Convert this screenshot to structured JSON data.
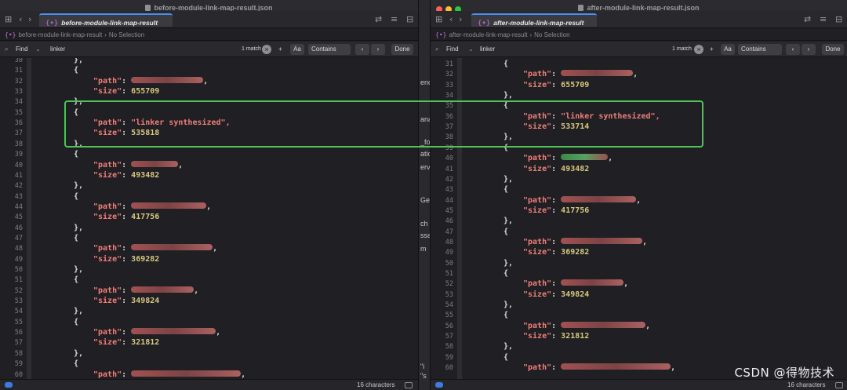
{
  "left": {
    "title": "before-module-link-map-result.json",
    "tab_label": "before-module-link-map-result",
    "jump_file": "before-module-link-map-result",
    "jump_selection": "No Selection",
    "find_mode": "Find",
    "find_query": "linker",
    "match_count": "1 match",
    "match_case": "Aa",
    "contains": "Contains",
    "done": "Done",
    "status_count": "16 characters",
    "lines": [
      {
        "n": "30",
        "t": "punc",
        "v": "},"
      },
      {
        "n": "31",
        "t": "punc",
        "v": "{"
      },
      {
        "n": "32",
        "t": "kv",
        "k": "\"path\"",
        "v": "",
        "redacted": true
      },
      {
        "n": "33",
        "t": "kvnum",
        "k": "\"size\"",
        "v": "655709"
      },
      {
        "n": "34",
        "t": "punc",
        "v": "},"
      },
      {
        "n": "35",
        "t": "punc",
        "v": "{"
      },
      {
        "n": "36",
        "t": "kvstr",
        "k": "\"path\"",
        "v": "\"linker synthesized\","
      },
      {
        "n": "37",
        "t": "kvnum",
        "k": "\"size\"",
        "v": "535818"
      },
      {
        "n": "38",
        "t": "punc",
        "v": "},"
      },
      {
        "n": "39",
        "t": "punc",
        "v": "{"
      },
      {
        "n": "40",
        "t": "kv",
        "k": "\"path\"",
        "v": "",
        "redacted": true
      },
      {
        "n": "41",
        "t": "kvnum",
        "k": "\"size\"",
        "v": "493482"
      },
      {
        "n": "42",
        "t": "punc",
        "v": "},"
      },
      {
        "n": "43",
        "t": "punc",
        "v": "{"
      },
      {
        "n": "44",
        "t": "kv",
        "k": "\"path\"",
        "v": "",
        "redacted": true
      },
      {
        "n": "45",
        "t": "kvnum",
        "k": "\"size\"",
        "v": "417756"
      },
      {
        "n": "46",
        "t": "punc",
        "v": "},"
      },
      {
        "n": "47",
        "t": "punc",
        "v": "{"
      },
      {
        "n": "48",
        "t": "kv",
        "k": "\"path\"",
        "v": "",
        "redacted": true
      },
      {
        "n": "49",
        "t": "kvnum",
        "k": "\"size\"",
        "v": "369282"
      },
      {
        "n": "50",
        "t": "punc",
        "v": "},"
      },
      {
        "n": "51",
        "t": "punc",
        "v": "{"
      },
      {
        "n": "52",
        "t": "kv",
        "k": "\"path\"",
        "v": "",
        "redacted": true
      },
      {
        "n": "53",
        "t": "kvnum",
        "k": "\"size\"",
        "v": "349824"
      },
      {
        "n": "54",
        "t": "punc",
        "v": "},"
      },
      {
        "n": "55",
        "t": "punc",
        "v": "{"
      },
      {
        "n": "56",
        "t": "kv",
        "k": "\"path\"",
        "v": "",
        "redacted": true
      },
      {
        "n": "57",
        "t": "kvnum",
        "k": "\"size\"",
        "v": "321812"
      },
      {
        "n": "58",
        "t": "punc",
        "v": "},"
      },
      {
        "n": "59",
        "t": "punc",
        "v": "{"
      },
      {
        "n": "60",
        "t": "kv",
        "k": "\"path\"",
        "v": "",
        "redacted": true
      }
    ]
  },
  "right": {
    "title": "after-module-link-map-result.json",
    "tab_label": "after-module-link-map-result",
    "jump_file": "after-module-link-map-result",
    "jump_selection": "No Selection",
    "find_mode": "Find",
    "find_query": "linker",
    "match_count": "1 match",
    "match_case": "Aa",
    "contains": "Contains",
    "done": "Done",
    "status_count": "16 characters",
    "lines": [
      {
        "n": "31",
        "t": "punc",
        "v": "{"
      },
      {
        "n": "32",
        "t": "kv",
        "k": "\"path\"",
        "v": "",
        "redacted": true
      },
      {
        "n": "33",
        "t": "kvnum",
        "k": "\"size\"",
        "v": "655709"
      },
      {
        "n": "34",
        "t": "punc",
        "v": "},"
      },
      {
        "n": "35",
        "t": "punc",
        "v": "{"
      },
      {
        "n": "36",
        "t": "kvstr",
        "k": "\"path\"",
        "v": "\"linker synthesized\","
      },
      {
        "n": "37",
        "t": "kvnum",
        "k": "\"size\"",
        "v": "533714"
      },
      {
        "n": "38",
        "t": "punc",
        "v": "},"
      },
      {
        "n": "39",
        "t": "punc",
        "v": "{"
      },
      {
        "n": "40",
        "t": "kv",
        "k": "\"path\"",
        "v": "",
        "redacted": true
      },
      {
        "n": "41",
        "t": "kvnum",
        "k": "\"size\"",
        "v": "493482"
      },
      {
        "n": "42",
        "t": "punc",
        "v": "},"
      },
      {
        "n": "43",
        "t": "punc",
        "v": "{"
      },
      {
        "n": "44",
        "t": "kv",
        "k": "\"path\"",
        "v": "",
        "redacted": true
      },
      {
        "n": "45",
        "t": "kvnum",
        "k": "\"size\"",
        "v": "417756"
      },
      {
        "n": "46",
        "t": "punc",
        "v": "},"
      },
      {
        "n": "47",
        "t": "punc",
        "v": "{"
      },
      {
        "n": "48",
        "t": "kv",
        "k": "\"path\"",
        "v": "",
        "redacted": true
      },
      {
        "n": "49",
        "t": "kvnum",
        "k": "\"size\"",
        "v": "369282"
      },
      {
        "n": "50",
        "t": "punc",
        "v": "},"
      },
      {
        "n": "51",
        "t": "punc",
        "v": "{"
      },
      {
        "n": "52",
        "t": "kv",
        "k": "\"path\"",
        "v": "",
        "redacted": true
      },
      {
        "n": "53",
        "t": "kvnum",
        "k": "\"size\"",
        "v": "349824"
      },
      {
        "n": "54",
        "t": "punc",
        "v": "},"
      },
      {
        "n": "55",
        "t": "punc",
        "v": "{"
      },
      {
        "n": "56",
        "t": "kv",
        "k": "\"path\"",
        "v": "",
        "redacted": true
      },
      {
        "n": "57",
        "t": "kvnum",
        "k": "\"size\"",
        "v": "321812"
      },
      {
        "n": "58",
        "t": "punc",
        "v": "},"
      },
      {
        "n": "59",
        "t": "punc",
        "v": "{"
      },
      {
        "n": "60",
        "t": "kv",
        "k": "\"path\"",
        "v": "",
        "redacted": true
      }
    ]
  },
  "gap_fragments": [
    "enc",
    "ana",
    "_fo",
    "atic",
    "ervi",
    "Gene",
    "ch",
    "ssag",
    "m",
    "\"i",
    "\"s"
  ],
  "watermark": "CSDN @得物技术",
  "colors": {
    "key": "#f07f78",
    "number": "#d8c77e",
    "highlight_box": "#4ec356",
    "tab_accent": "#4a8ff0",
    "redaction": "#b85a5a"
  }
}
